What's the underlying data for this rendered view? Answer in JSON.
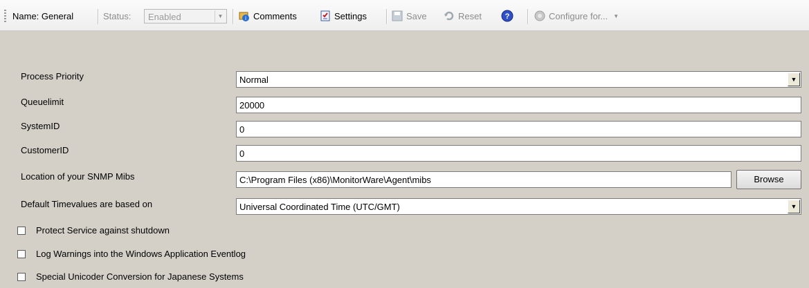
{
  "toolbar": {
    "name_label": "Name: General",
    "status_label": "Status:",
    "status_value": "Enabled",
    "comments_label": "Comments",
    "settings_label": "Settings",
    "save_label": "Save",
    "reset_label": "Reset",
    "configure_label": "Configure for...",
    "icons": [
      "comments-icon",
      "settings-icon",
      "save-icon",
      "reset-icon",
      "help-icon",
      "configure-icon"
    ]
  },
  "form": {
    "process_priority": {
      "label": "Process Priority",
      "value": "Normal"
    },
    "queuelimit": {
      "label": "Queuelimit",
      "value": "20000"
    },
    "system_id": {
      "label": "SystemID",
      "value": "0"
    },
    "customer_id": {
      "label": "CustomerID",
      "value": "0"
    },
    "snmp_mibs": {
      "label": "Location of your SNMP Mibs",
      "value": "C:\\Program Files (x86)\\MonitorWare\\Agent\\mibs",
      "button": "Browse"
    },
    "timevalues": {
      "label": "Default Timevalues are based on",
      "value": "Universal Coordinated Time (UTC/GMT)"
    }
  },
  "checkboxes": [
    {
      "label": "Protect Service against shutdown",
      "checked": false
    },
    {
      "label": "Log Warnings into the Windows Application Eventlog",
      "checked": false
    },
    {
      "label": "Special Unicoder Conversion for Japanese Systems",
      "checked": false
    }
  ]
}
